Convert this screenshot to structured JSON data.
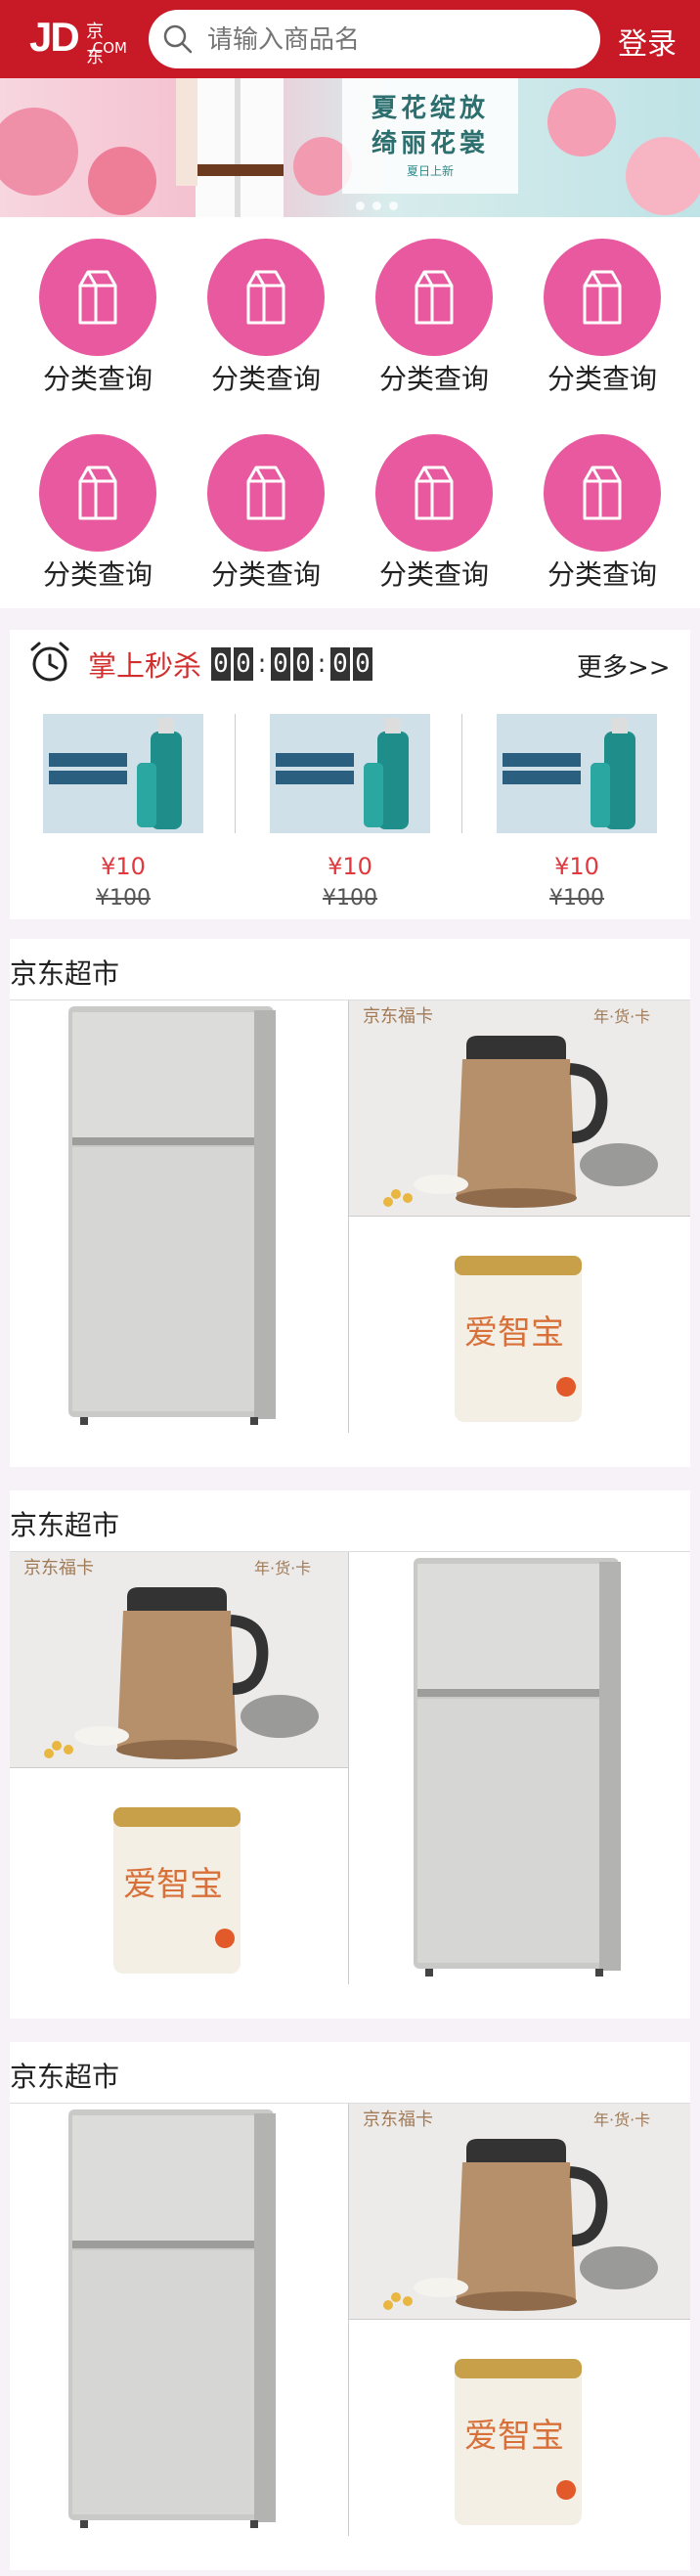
{
  "header": {
    "logo_jd": "JD",
    "logo_cn": "京东",
    "logo_com": ".COM",
    "search_placeholder": "请输入商品名",
    "login": "登录"
  },
  "banner": {
    "line1": "夏花绽放",
    "line2": "绮丽花裳",
    "line3": "夏日上新"
  },
  "categories": [
    {
      "label": "分类查询"
    },
    {
      "label": "分类查询"
    },
    {
      "label": "分类查询"
    },
    {
      "label": "分类查询"
    },
    {
      "label": "分类查询"
    },
    {
      "label": "分类查询"
    },
    {
      "label": "分类查询"
    },
    {
      "label": "分类查询"
    }
  ],
  "seckill": {
    "title": "掌上秒杀",
    "timer": [
      "0",
      "0",
      "0",
      "0",
      "0",
      "0"
    ],
    "more": "更多>>",
    "items": [
      {
        "price": "¥10",
        "old_price": "¥100"
      },
      {
        "price": "¥10",
        "old_price": "¥100"
      },
      {
        "price": "¥10",
        "old_price": "¥100"
      }
    ]
  },
  "floors": [
    {
      "title": "京东超市",
      "card_brand": "京东福卡",
      "card_tag": "年·货·卡",
      "can_name": "爱智宝"
    },
    {
      "title": "京东超市",
      "card_brand": "京东福卡",
      "card_tag": "年·货·卡",
      "can_name": "爱智宝"
    },
    {
      "title": "京东超市",
      "card_brand": "京东福卡",
      "card_tag": "年·货·卡",
      "can_name": "爱智宝"
    }
  ],
  "colors": {
    "header_red": "#c71a26",
    "category_pink": "#e8599f",
    "price_red": "#e0393e"
  }
}
